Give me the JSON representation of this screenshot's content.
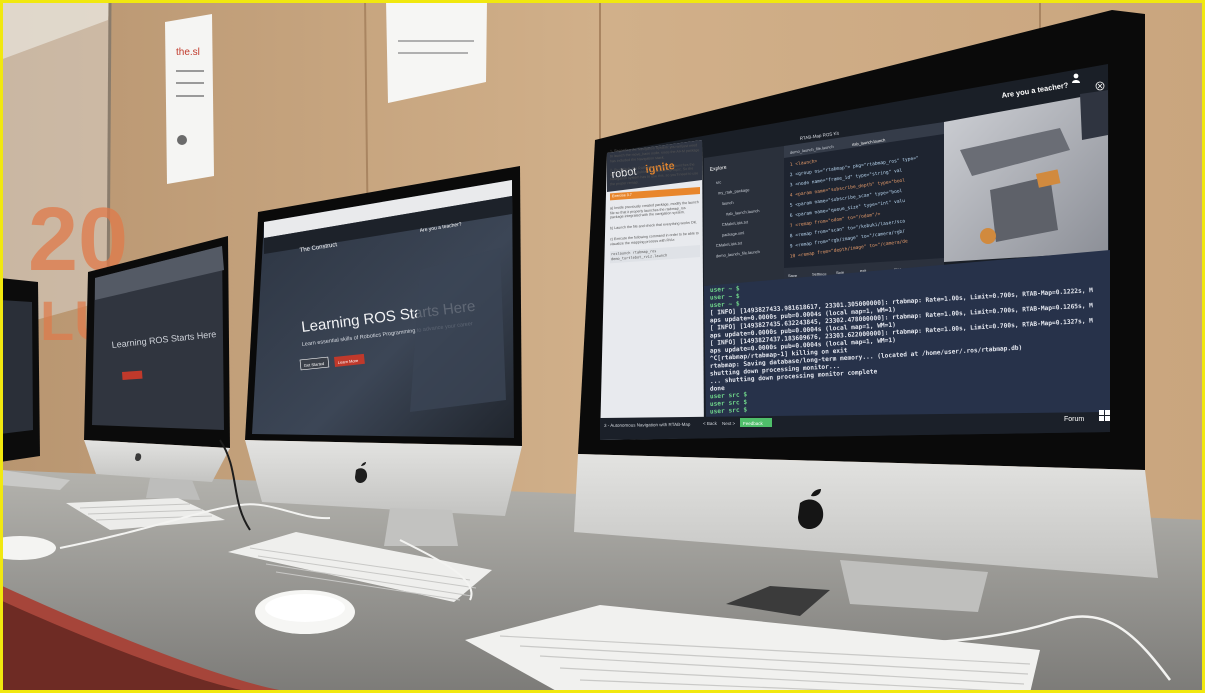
{
  "poster": {
    "title": "the.sl",
    "big_text": "20",
    "side_text": "LUTI"
  },
  "left_monitor": {
    "title": "Learning ROS Starts Here"
  },
  "middle_monitor": {
    "brand": "The Construct",
    "headline": "Learning ROS Starts Here",
    "subline": "Learn essential skills of Robotics Programming to advance your career",
    "teacher_link": "Are you a teacher?",
    "btn_primary": "Get Started",
    "btn_secondary": "Learn More"
  },
  "right_monitor": {
    "brand_a": "robot",
    "brand_b": "ignite",
    "teacher_prompt": "Are you a teacher?",
    "window_title": "RTAB-Map ROS Kit",
    "tabs": [
      "demo_launch_file.launch",
      "rtab_launch.launch"
    ],
    "explorer": {
      "title": "Explore",
      "items": [
        "src",
        "my_rtab_package",
        "launch",
        "rtab_launch.launch",
        "CMakeLists.txt",
        "package.xml",
        "CMakeLists.txt",
        "demo_launch_file.launch"
      ]
    },
    "code_lines": [
      "<launch>",
      "  <group ns=\"rtabmap\"> pkg=\"rtabmap_ros\" type=\"",
      "    <node name=\"frame_id\" type=\"string\" val",
      "      <param name=\"subscribe_depth\" type=\"bool",
      "      <param name=\"subscribe_scan\" type=\"bool",
      "      <param name=\"queue_size\" type=\"int\" valu",
      "      <remap from=\"odom\" to=\"/odom\"/>",
      "      <remap from=\"scan\" to=\"/kobuki/laser/sca",
      "      <remap from=\"rgb/image\" to=\"/camera/rgb/",
      "      <remap from=\"depth/image\" to=\"/camera/de"
    ],
    "editor_bar": [
      "Save",
      "Settings",
      "Split",
      "exit",
      "src/my_rtab_package/launch"
    ],
    "notebook": {
      "p1": "1- Regarding the Navigation System: you will just need to launch the move_base node, since the AI+M package has included the Navigation stack.",
      "p2": "2- By default, the RABMap ros package launches the grid map that it's publishing in the /map topic. So the Navigation system has to use this, so you'll need to use the proper remap.",
      "exercise": "Exercise 3.7",
      "p3": "a) Inside previously created package, modify the launch file so that it properly launches the rtabmap_ros package integrated with the navigation system.",
      "p4": "b) Launch the file and check that everything works OK.",
      "p5": "c) Execute the following command in order to be able to visualize the mapping process with RViz:",
      "code": "roslaunch rtabmap_ros demo_turtlebot_rviz.launch"
    },
    "terminal_lines": [
      "user ~ $",
      "user ~ $",
      "user ~ $",
      "[ INFO] [1493827433.981618617, 23301.305000000]: rtabmap: Rate=1.00s, Limit=0.700s, RTAB-Map=0.1222s, M",
      "aps update=0.0000s pub=0.0004s (local map=1, WM=1)",
      "[ INFO] [1493827435.632243845, 23302.478000000]: rtabmap: Rate=1.00s, Limit=0.700s, RTAB-Map=0.1265s, M",
      "aps update=0.0000s pub=0.0004s (local map=1, WM=1)",
      "[ INFO] [1493827437.183609676, 23303.622000000]: rtabmap: Rate=1.00s, Limit=0.700s, RTAB-Map=0.1327s, M",
      "aps update=0.0000s pub=0.0004s (local map=1, WM=1)",
      "^C[rtabmap/rtabmap-1] killing on exit",
      "rtabmap: Saving database/long-term memory... (located at /home/user/.ros/rtabmap.db)",
      "shutting down processing monitor...",
      "... shutting down processing monitor complete",
      "done",
      "user src $",
      "user src $",
      "user src $"
    ],
    "footer": {
      "unit": "3 - Autonomous Navigation with RTAB-Map",
      "back": "< Back",
      "next": "Next >",
      "feedback": "Feedback",
      "forum": "Forum"
    }
  },
  "colors": {
    "frame": "#f1e80f",
    "wall": "#c9a884",
    "desk": "#9c9c98",
    "aluminium": "#d2d2d0",
    "bezel": "#0b0b0b",
    "terminal_bg": "#27324a",
    "terminal_text": "#e3e6ee",
    "accent_orange": "#e8862c",
    "accent_green": "#4fbf6a"
  }
}
